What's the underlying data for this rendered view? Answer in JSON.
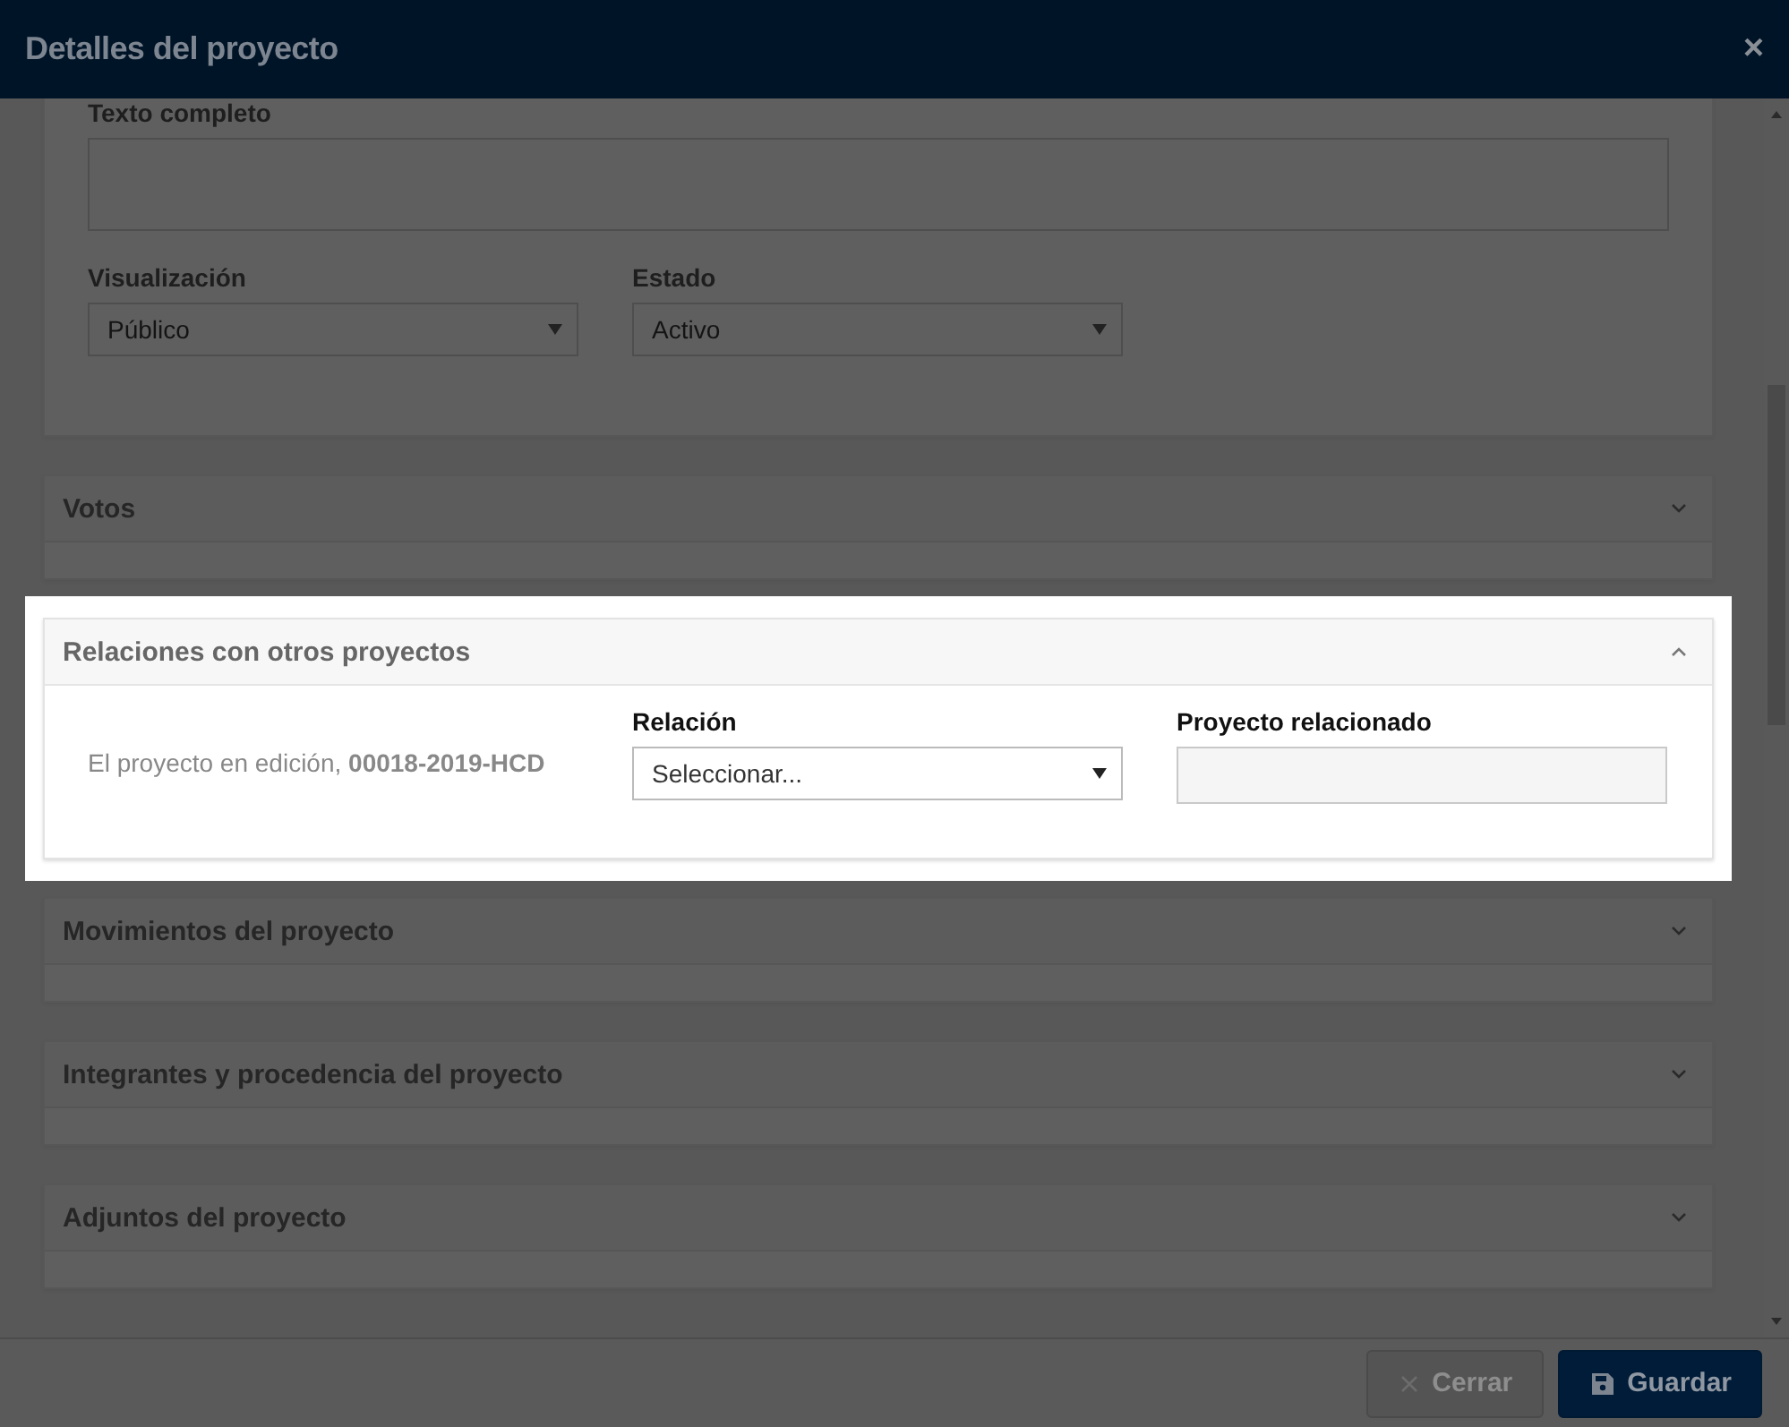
{
  "dialog": {
    "title": "Detalles del proyecto",
    "close_symbol": "×"
  },
  "top_panel": {
    "textarea_label": "Texto completo",
    "fields": [
      {
        "label": "Visualización",
        "value": "Público"
      },
      {
        "label": "Estado",
        "value": "Activo"
      }
    ]
  },
  "sections": [
    {
      "title": "Votos",
      "expanded": false,
      "highlighted": false
    },
    {
      "title": "Relaciones con otros proyectos",
      "expanded": true,
      "highlighted": true,
      "description": "El proyecto en edición, **00018-2019-HCD**",
      "relation": {
        "label": "Relación",
        "value": "Seleccionar..."
      },
      "related": {
        "label": "Proyecto relacionado"
      }
    },
    {
      "title": "Movimientos del proyecto",
      "expanded": false,
      "highlighted": false
    },
    {
      "title": "Integrantes y procedencia del proyecto",
      "expanded": false,
      "highlighted": false
    },
    {
      "title": "Adjuntos del proyecto",
      "expanded": false,
      "highlighted": false
    }
  ],
  "buttons": [
    {
      "label": "Cerrar",
      "kind": "close",
      "disabled": true
    },
    {
      "label": "Guardar",
      "kind": "save",
      "disabled": false
    }
  ]
}
